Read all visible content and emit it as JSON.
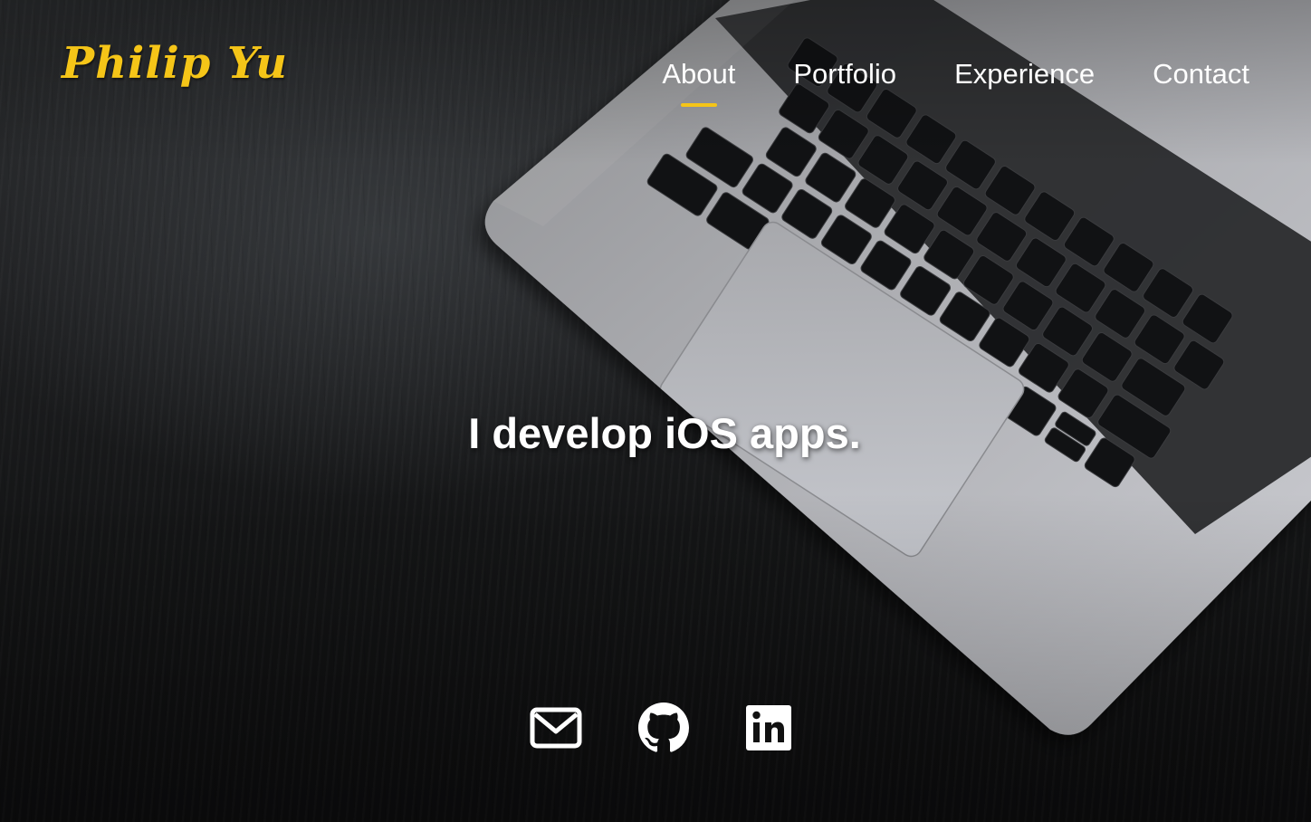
{
  "site": {
    "logo": "Philip Yu",
    "accent_color": "#f5c518"
  },
  "nav": {
    "items": [
      {
        "label": "About",
        "active": true
      },
      {
        "label": "Portfolio",
        "active": false
      },
      {
        "label": "Experience",
        "active": false
      },
      {
        "label": "Contact",
        "active": false
      }
    ]
  },
  "hero": {
    "headline": "I develop iOS apps."
  },
  "socials": [
    {
      "icon": "mail-icon"
    },
    {
      "icon": "github-icon"
    },
    {
      "icon": "linkedin-icon"
    }
  ]
}
